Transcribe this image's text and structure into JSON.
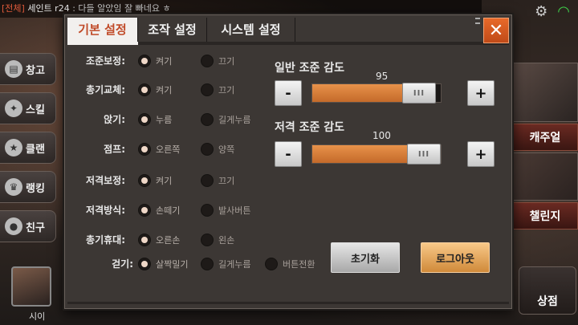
{
  "chat": {
    "channel": "[전체]",
    "name": "세인트 r24",
    "message": ": 다들 알았임 잘 빠네요 ㅎ"
  },
  "lobby": {
    "menu": [
      "창고",
      "스킬",
      "클랜",
      "랭킹",
      "친구"
    ],
    "username": "시이",
    "right_buttons": [
      "캐주얼",
      "챌린지"
    ],
    "shop_label": "상점"
  },
  "tabs": {
    "basic": "기본 설정",
    "control": "조작 설정",
    "system": "시스템 설정"
  },
  "close_label": "✕",
  "settings": [
    {
      "label": "조준보정:",
      "opt1": "켜기",
      "opt2": "끄기",
      "opt3": "",
      "selected": 1
    },
    {
      "label": "총기교체:",
      "opt1": "켜기",
      "opt2": "끄기",
      "opt3": "",
      "selected": 1
    },
    {
      "label": "앉기:",
      "opt1": "누름",
      "opt2": "길게누름",
      "opt3": "",
      "selected": 1
    },
    {
      "label": "점프:",
      "opt1": "오른쪽",
      "opt2": "양쪽",
      "opt3": "",
      "selected": 1
    },
    {
      "label": "저격보정:",
      "opt1": "켜기",
      "opt2": "끄기",
      "opt3": "",
      "selected": 1
    },
    {
      "label": "저격방식:",
      "opt1": "손떼기",
      "opt2": "발사버튼",
      "opt3": "",
      "selected": 1
    },
    {
      "label": "총기휴대:",
      "opt1": "오른손",
      "opt2": "왼손",
      "opt3": "",
      "selected": 1
    },
    {
      "label": "걷기:",
      "opt1": "살짝밀기",
      "opt2": "길게누름",
      "opt3": "버튼전환",
      "selected": 1
    }
  ],
  "normal_sens": {
    "title": "일반 조준 감도",
    "value": "95",
    "level": 0.95
  },
  "sniper_sens": {
    "title": "저격 조준 감도",
    "value": "100",
    "level": 1.0
  },
  "minus_label": "-",
  "plus_label": "+",
  "thumb_label": "III",
  "reset_label": "초기화",
  "logout_label": "로그아웃"
}
